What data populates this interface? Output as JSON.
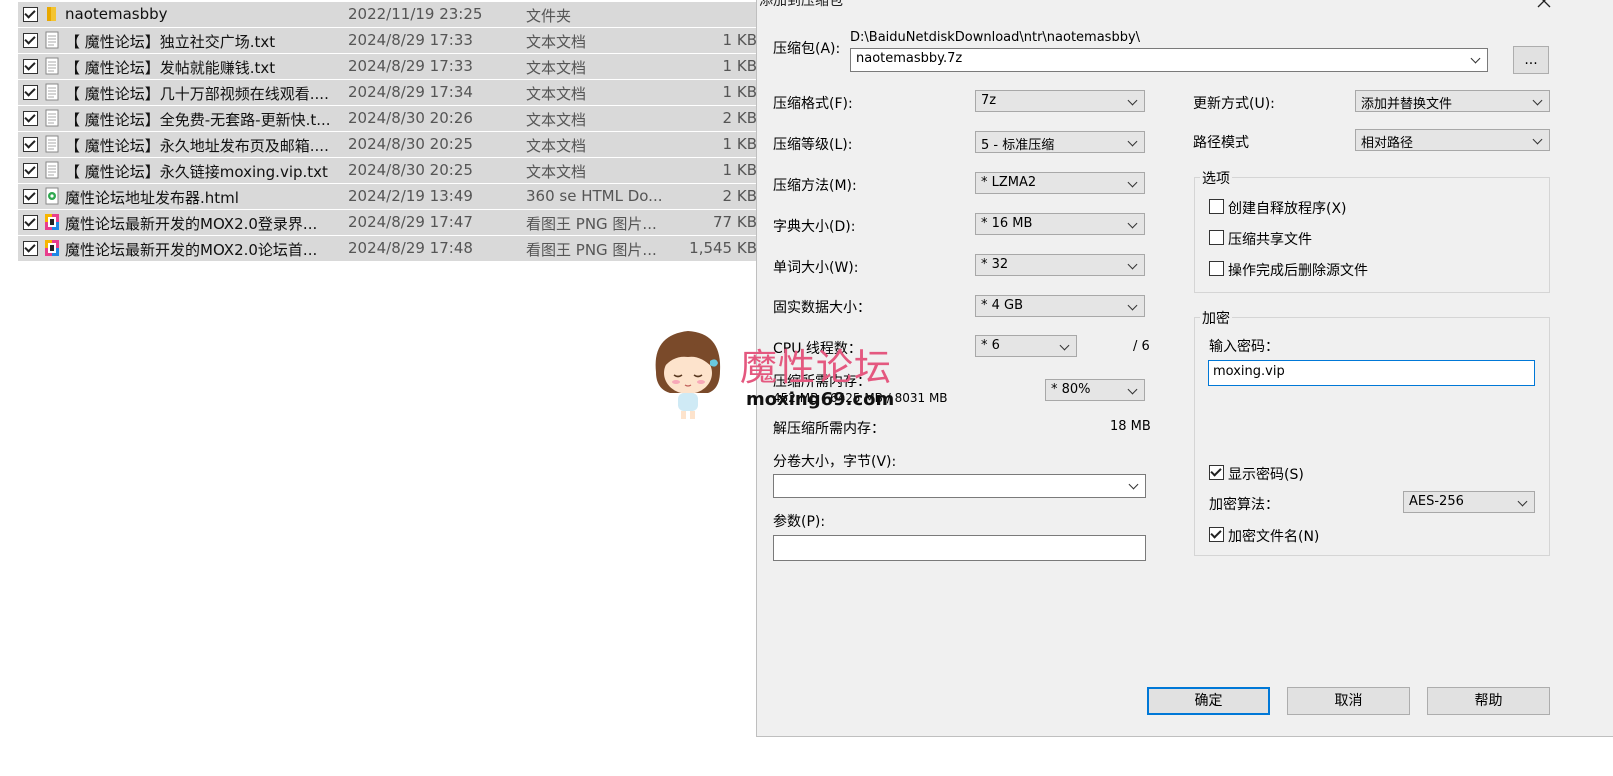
{
  "files": [
    {
      "name": "naotemasbby",
      "date": "2022/11/19 23:25",
      "type": "文件夹",
      "size": "",
      "icon": "folder-icon"
    },
    {
      "name": "【 魔性论坛】独立社交广场.txt",
      "date": "2024/8/29 17:33",
      "type": "文本文档",
      "size": "1 KB",
      "icon": "text-file-icon"
    },
    {
      "name": "【 魔性论坛】发帖就能赚钱.txt",
      "date": "2024/8/29 17:33",
      "type": "文本文档",
      "size": "1 KB",
      "icon": "text-file-icon"
    },
    {
      "name": "【 魔性论坛】几十万部视频在线观看....",
      "date": "2024/8/29 17:34",
      "type": "文本文档",
      "size": "1 KB",
      "icon": "text-file-icon"
    },
    {
      "name": "【 魔性论坛】全免费-无套路-更新快.t...",
      "date": "2024/8/30 20:26",
      "type": "文本文档",
      "size": "2 KB",
      "icon": "text-file-icon"
    },
    {
      "name": "【 魔性论坛】永久地址发布页及邮箱....",
      "date": "2024/8/30 20:25",
      "type": "文本文档",
      "size": "1 KB",
      "icon": "text-file-icon"
    },
    {
      "name": "【 魔性论坛】永久链接moxing.vip.txt",
      "date": "2024/8/30 20:25",
      "type": "文本文档",
      "size": "1 KB",
      "icon": "text-file-icon"
    },
    {
      "name": "魔性论坛地址发布器.html",
      "date": "2024/2/19 13:49",
      "type": "360 se HTML Do...",
      "size": "2 KB",
      "icon": "html-file-icon"
    },
    {
      "name": "魔性论坛最新开发的MOX2.0登录界...",
      "date": "2024/8/29 17:47",
      "type": "看图王 PNG 图片...",
      "size": "77 KB",
      "icon": "image-file-icon"
    },
    {
      "name": "魔性论坛最新开发的MOX2.0论坛首...",
      "date": "2024/8/29 17:48",
      "type": "看图王 PNG 图片...",
      "size": "1,545 KB",
      "icon": "image-file-icon"
    }
  ],
  "watermark": {
    "text": "魔性论坛",
    "url": "moxing69.com"
  },
  "dialog": {
    "title": "添加到压缩包",
    "archive_label": "压缩包(A):",
    "archive_path": "D:\\BaiduNetdiskDownload\\ntr\\naotemasbby\\",
    "archive_name": "naotemasbby.7z",
    "browse_label": "...",
    "format_label": "压缩格式(F):",
    "format_value": "7z",
    "level_label": "压缩等级(L):",
    "level_value": "5 - 标准压缩",
    "method_label": "压缩方法(M):",
    "method_value": "*  LZMA2",
    "dict_label": "字典大小(D):",
    "dict_value": "*  16 MB",
    "word_label": "单词大小(W):",
    "word_value": "*  32",
    "solid_label": "固实数据大小：",
    "solid_value": "*  4 GB",
    "cpu_label": "CPU 线程数：",
    "cpu_value": "*  6",
    "cpu_total": "/ 6",
    "mem_comp_label": "压缩所需内存：",
    "mem_comp_value": "452 MB / 6425 MB / 8031 MB",
    "mem_comp_select": "* 80%",
    "mem_decomp_label": "解压缩所需内存：",
    "mem_decomp_value": "18 MB",
    "volume_label": "分卷大小，字节(V):",
    "volume_value": "",
    "params_label": "参数(P):",
    "params_value": "",
    "update_label": "更新方式(U):",
    "update_value": "添加并替换文件",
    "path_label": "路径模式",
    "path_value": "相对路径",
    "options_label": "选项",
    "opt_sfx": "创建自释放程序(X)",
    "opt_shared": "压缩共享文件",
    "opt_delete": "操作完成后删除源文件",
    "encrypt_label": "加密",
    "password_label": "输入密码：",
    "password_value": "moxing.vip",
    "show_password": "显示密码(S)",
    "enc_method_label": "加密算法：",
    "enc_method_value": "AES-256",
    "encrypt_names": "加密文件名(N)",
    "ok": "确定",
    "cancel": "取消",
    "help": "帮助"
  }
}
